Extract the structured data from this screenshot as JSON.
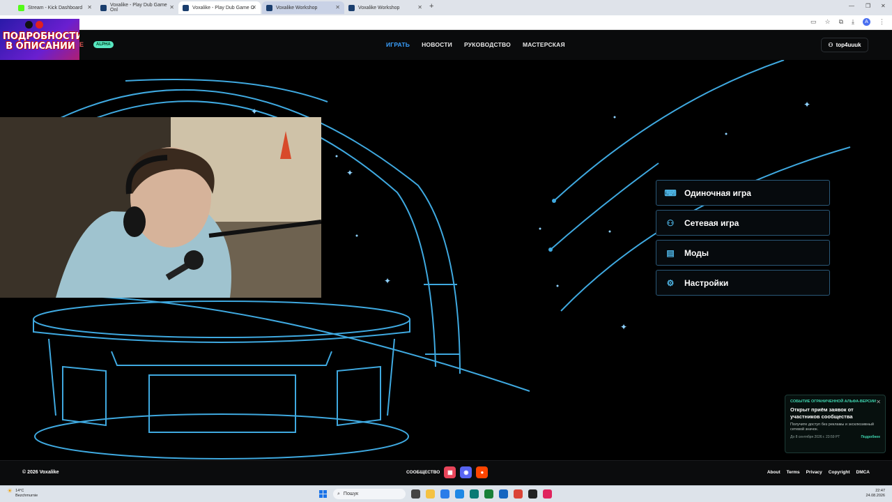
{
  "browser": {
    "tabs": [
      {
        "title": "Stream - Kick Dashboard",
        "color": "#53fc18"
      },
      {
        "title": "Voxalike - Play Dub Game Onl",
        "color": "#1a3e6e"
      },
      {
        "title": "Voxalike - Play Dub Game O",
        "color": "#1a3e6e"
      },
      {
        "title": "Voxalike Workshop",
        "color": "#1a3e6e"
      },
      {
        "title": "Voxalike Workshop",
        "color": "#1a3e6e"
      }
    ],
    "new_tab": "+",
    "profile_initial": "A"
  },
  "promo": {
    "text": "ПОДРОБНОСТИ В ОПИСАНИИ"
  },
  "header": {
    "logo_tail": "E",
    "badge": "ALPHA",
    "nav": [
      {
        "label": "ИГРАТЬ",
        "active": true
      },
      {
        "label": "НОВОСТИ"
      },
      {
        "label": "РУКОВОДСТВО"
      },
      {
        "label": "МАСТЕРСКАЯ"
      }
    ],
    "username": "top4uuuk"
  },
  "menu": [
    {
      "label": "Одиночная игра",
      "icon": "gamepad-icon"
    },
    {
      "label": "Сетевая игра",
      "icon": "users-icon"
    },
    {
      "label": "Моды",
      "icon": "file-icon"
    },
    {
      "label": "Настройки",
      "icon": "gear-icon"
    }
  ],
  "notice": {
    "tag": "СОБЫТИЕ ОГРАНИЧЕННОЙ АЛЬФА-ВЕРСИИ",
    "heading": "Открыт приём заявок от участников сообщества",
    "body": "Получите доступ без рекламы и эксклюзивный сетевой значок.",
    "date": "До 8 сентября 2026 г. 23:59 PT",
    "more": "Подробнее"
  },
  "footer": {
    "copyright": "© 2026 Voxalike",
    "community": "СООБЩЕСТВО",
    "links": [
      "About",
      "Terms",
      "Privacy",
      "Copyright",
      "DMCA"
    ]
  },
  "taskbar": {
    "temp": "14°C",
    "weather": "Bezchmurnie",
    "search": "Пошук",
    "time": "22:47",
    "date": "24.08.2026"
  },
  "colors": {
    "accent": "#3aa0ff",
    "line": "#3fa9e0",
    "badge": "#58e6c0"
  }
}
